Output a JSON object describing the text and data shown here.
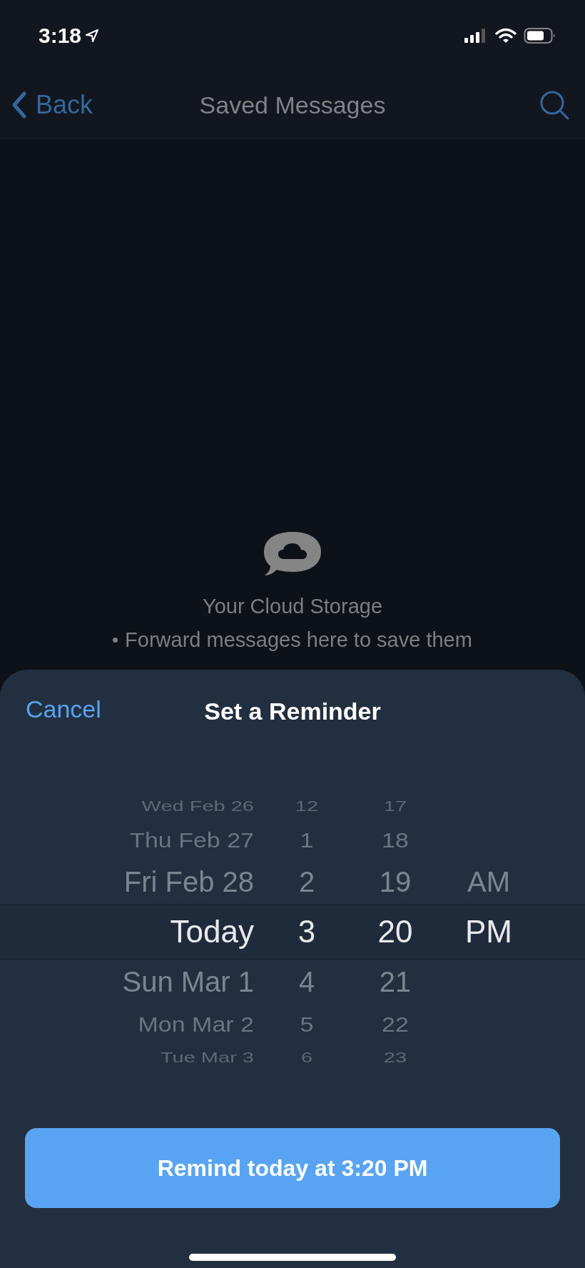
{
  "status_bar": {
    "time": "3:18"
  },
  "nav_bar": {
    "back": "Back",
    "title": "Saved Messages"
  },
  "empty_state": {
    "title": "Your Cloud Storage",
    "bullets": [
      "Forward messages here to save them"
    ]
  },
  "sheet": {
    "cancel": "Cancel",
    "title": "Set a Reminder",
    "picker_rows": [
      {
        "date": "Wed Feb 26",
        "hour": "12",
        "minute": "17",
        "selected": false
      },
      {
        "date": "Thu Feb 27",
        "hour": "1",
        "minute": "18",
        "selected": false
      },
      {
        "date": "Fri Feb 28",
        "hour": "2",
        "minute": "19",
        "ampm": "AM",
        "selected": false
      },
      {
        "date": "Today",
        "hour": "3",
        "minute": "20",
        "ampm": "PM",
        "selected": true
      },
      {
        "date": "Sun Mar 1",
        "hour": "4",
        "minute": "21",
        "selected": false
      },
      {
        "date": "Mon Mar 2",
        "hour": "5",
        "minute": "22",
        "selected": false
      },
      {
        "date": "Tue Mar 3",
        "hour": "6",
        "minute": "23",
        "selected": false
      }
    ],
    "confirm_button": "Remind today at 3:20 PM"
  }
}
